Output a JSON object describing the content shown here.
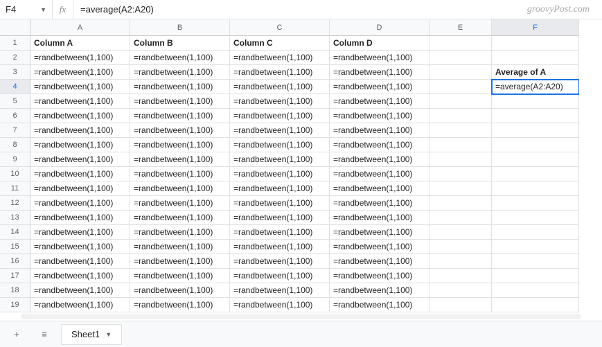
{
  "watermark": "groovyPost.com",
  "name_box": "F4",
  "fx_label": "fx",
  "formula": "=average(A2:A20)",
  "columns": [
    "A",
    "B",
    "C",
    "D",
    "E",
    "F"
  ],
  "col_widths": [
    "col-A",
    "col-B",
    "col-C",
    "col-D",
    "col-E",
    "col-F"
  ],
  "active_col_index": 5,
  "active_row": 4,
  "selected": {
    "col": 5,
    "row": 4
  },
  "header_row": [
    "Column A",
    "Column B",
    "Column C",
    "Column D",
    "",
    ""
  ],
  "rb_formula": "=randbetween(1,100)",
  "rows": 19,
  "f3_label": "Average of A",
  "f4_value": "=average(A2:A20)",
  "chart_data": {
    "type": "table",
    "active_cell": "F4",
    "formula_bar": "=average(A2:A20)",
    "headers": {
      "A1": "Column A",
      "B1": "Column B",
      "C1": "Column C",
      "D1": "Column D"
    },
    "data_range": "A2:D19",
    "data_value": "=randbetween(1,100)",
    "F3": "Average of A",
    "F4": "=average(A2:A20)"
  },
  "tabs": {
    "add": "+",
    "menu": "≡",
    "sheet": "Sheet1",
    "arrow": "▼"
  }
}
